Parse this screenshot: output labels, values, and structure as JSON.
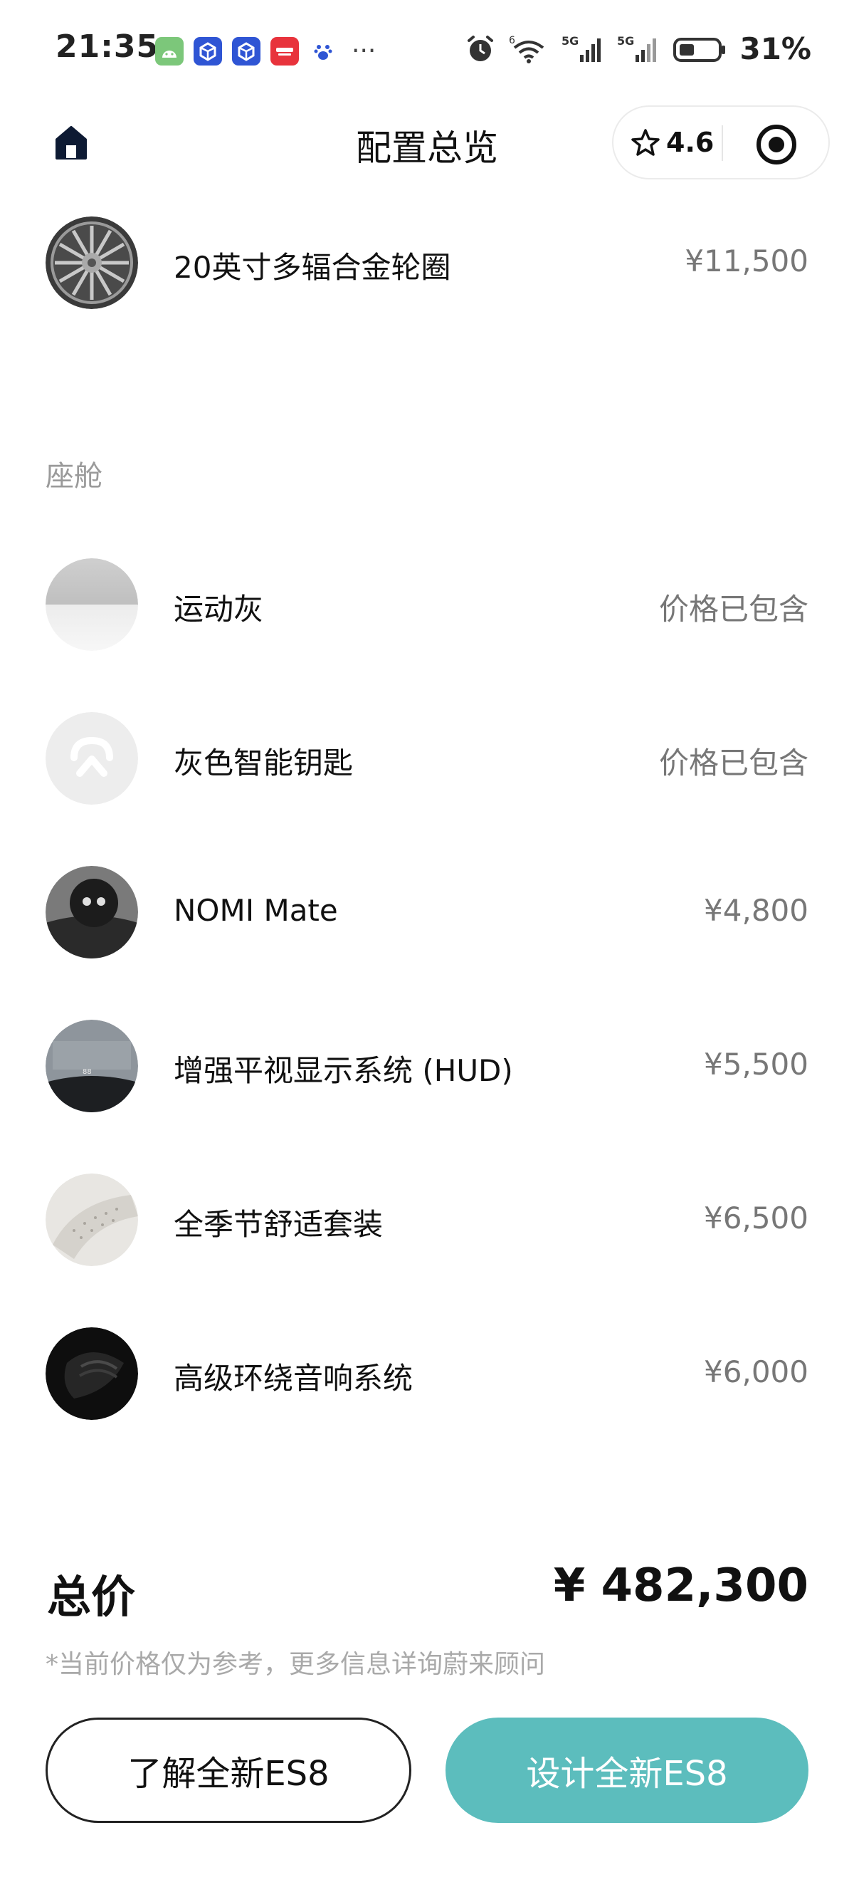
{
  "status_bar": {
    "time": "21:35",
    "battery": "31%",
    "icons": [
      "android-app-icon",
      "cube-app-icon",
      "cube-app-icon-2",
      "xiaohongshu-app-icon",
      "baidu-app-icon",
      "more-dots-icon",
      "alarm-icon",
      "wifi-icon",
      "signal-5g-icon",
      "signal-5g-icon-2",
      "battery-icon"
    ]
  },
  "header": {
    "title": "配置总览",
    "rating": "4.6"
  },
  "wheel_item": {
    "label": "20英寸多辐合金轮圈",
    "price": "¥11,500"
  },
  "cabin": {
    "section_title": "座舱",
    "items": [
      {
        "label": "运动灰",
        "price": "价格已包含"
      },
      {
        "label": "灰色智能钥匙",
        "price": "价格已包含"
      },
      {
        "label": "NOMI Mate",
        "price": "¥4,800"
      },
      {
        "label": "增强平视显示系统 (HUD)",
        "price": "¥5,500"
      },
      {
        "label": "全季节舒适套装",
        "price": "¥6,500"
      },
      {
        "label": "高级环绕音响系统",
        "price": "¥6,000"
      }
    ]
  },
  "footer": {
    "total_label": "总价",
    "total_value": "¥ 482,300",
    "disclaimer": "*当前价格仅为参考，更多信息详询蔚来顾问",
    "learn_button": "了解全新ES8",
    "design_button": "设计全新ES8"
  },
  "colors": {
    "accent": "#5cbdbd",
    "price_gray": "#777777",
    "muted": "#a9a9a9"
  }
}
